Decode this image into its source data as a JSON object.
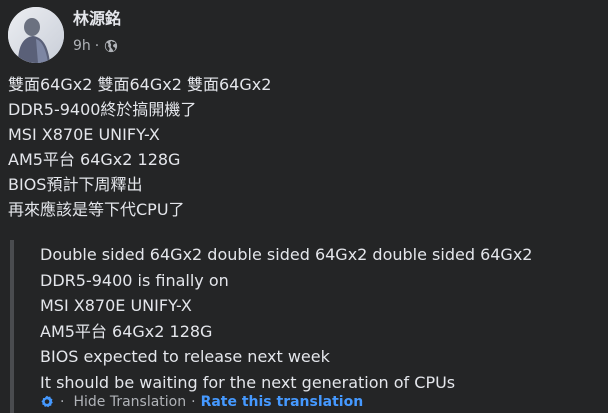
{
  "post": {
    "author": "林源銘",
    "time": "9h",
    "separator": "·",
    "audience_icon": "globe-icon",
    "avatar_icon": "profile-photo",
    "lines": [
      "雙面64Gx2 雙面64Gx2 雙面64Gx2",
      "DDR5-9400終於搞開機了",
      "MSI X870E UNIFY-X",
      "AM5平台 64Gx2 128G",
      "BIOS預計下周釋出",
      "再來應該是等下代CPU了"
    ]
  },
  "translation": {
    "lines": [
      "Double sided 64Gx2 double sided 64Gx2 double sided 64Gx2",
      "DDR5-9400 is finally on",
      "MSI X870E UNIFY-X",
      "AM5平台 64Gx2 128G",
      "BIOS expected to release next week",
      "It should be waiting for the next generation of CPUs"
    ],
    "footer": {
      "icon": "translate-gear-icon",
      "separator": "·",
      "hide_label": "Hide Translation",
      "rate_label": "Rate this translation"
    }
  },
  "colors": {
    "background": "#242526",
    "text_primary": "#e4e6eb",
    "text_secondary": "#b0b3b8",
    "link_blue": "#4599ff",
    "quote_bar": "#4a4c4f"
  }
}
